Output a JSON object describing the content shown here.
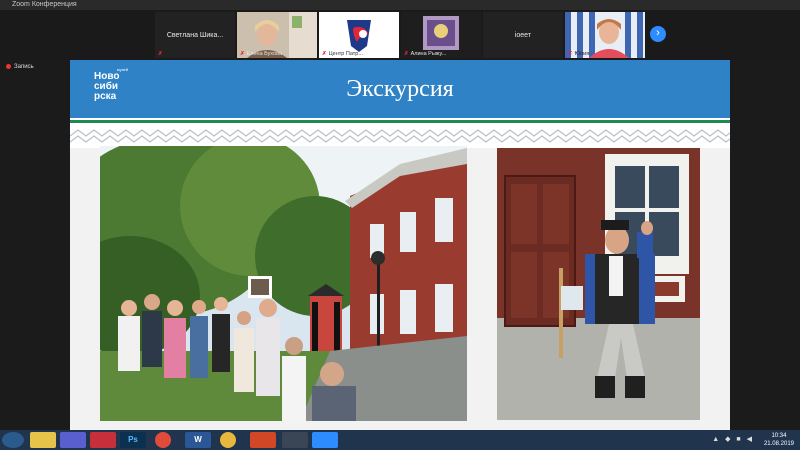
{
  "window": {
    "title": "Zoom Конференция"
  },
  "participants": [
    {
      "display_name": "Светлана Шика...",
      "footer": ""
    },
    {
      "display_name": "",
      "footer": "Елена Бухова"
    },
    {
      "display_name": "",
      "footer": "Центр Патр..."
    },
    {
      "display_name": "",
      "footer": "Алина Рыжу..."
    },
    {
      "display_name": "ioeeт",
      "footer": ""
    },
    {
      "display_name": "",
      "footer": "Юлия"
    }
  ],
  "recording": {
    "label": "Запись"
  },
  "slide": {
    "title": "Экскурсия",
    "logo": {
      "top": "музей",
      "line1": "Ново",
      "line2": "сиби",
      "line3": "рска"
    }
  },
  "taskbar": {
    "apps": [
      "explorer-icon",
      "zoom-icon",
      "app-icon",
      "photoshop-icon",
      "chrome-icon",
      "word-icon",
      "chrome-alt-icon",
      "powerpoint-icon",
      "mic-app-icon",
      "zoom-meeting-icon"
    ],
    "ps_label": "Ps",
    "word_label": "W",
    "clock_time": "10:34",
    "clock_date": "21.08.2019"
  },
  "colors": {
    "slide_header": "#2f82c6",
    "ornament": "#1d8a54",
    "taskbar": "#20354d",
    "accent": "#2d8cff"
  }
}
